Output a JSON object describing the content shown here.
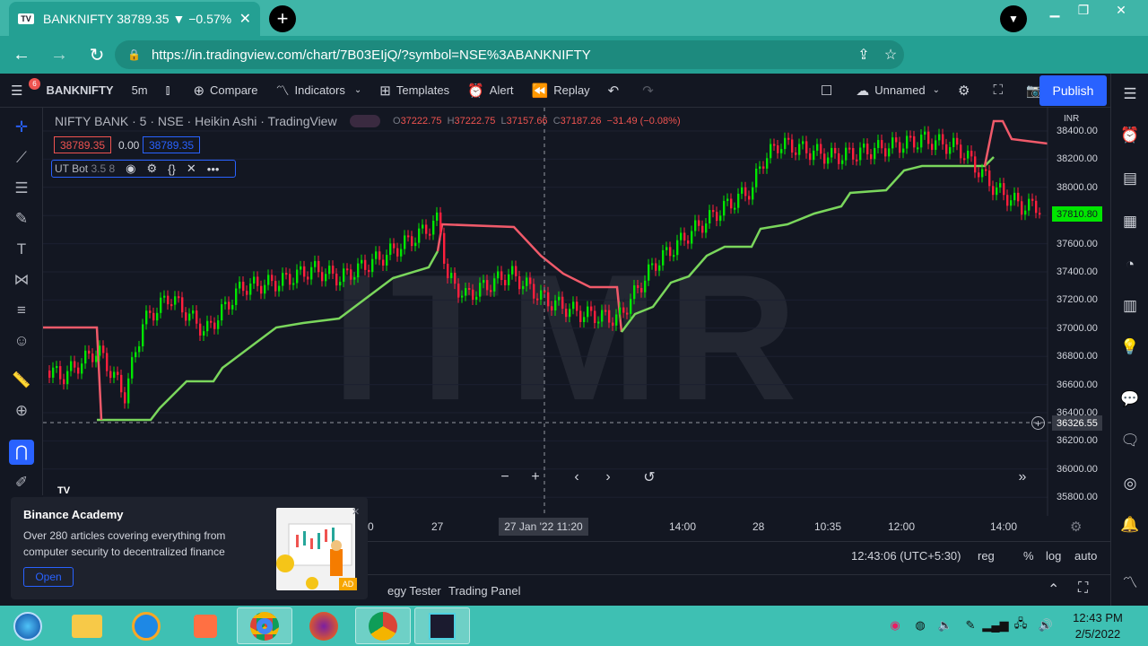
{
  "browser": {
    "tab_title": "BANKNIFTY 38789.35 ▼ −0.57% ",
    "tab_close": "✕",
    "new_tab": "+",
    "url": "https://in.tradingview.com/chart/7B03EIjQ/?symbol=NSE%3ABANKNIFTY"
  },
  "toolbar": {
    "symbol": "BANKNIFTY",
    "interval": "5m",
    "compare": "Compare",
    "indicators": "Indicators",
    "templates": "Templates",
    "alert": "Alert",
    "replay": "Replay",
    "layout_name": "Unnamed",
    "publish": "Publish",
    "notif_count": "6"
  },
  "legend": {
    "title": "NIFTY BANK · 5 · NSE · Heikin Ashi · TradingView",
    "o_label": "O",
    "o_value": "37222.75",
    "h_label": "H",
    "h_value": "37222.75",
    "l_label": "L",
    "l_value": "37157.66",
    "c_label": "C",
    "c_value": "37187.26",
    "change": "−31.49 (−0.08%)",
    "bid": "38789.35",
    "spread": "0.00",
    "ask": "38789.35",
    "indicator": "UT Bot",
    "indicator_params": "3.5 8"
  },
  "axis": {
    "currency": "INR",
    "price_ticks": [
      "38400.00",
      "38200.00",
      "38000.00",
      "37800.00",
      "37600.00",
      "37400.00",
      "37200.00",
      "37000.00",
      "36800.00",
      "36600.00",
      "36400.00",
      "36200.00",
      "36000.00",
      "35800.00"
    ],
    "last_price": "37810.80",
    "crosshair_price": "36326.55",
    "time_ticks": [
      "0",
      "27",
      "14:00",
      "28",
      "10:35",
      "12:00",
      "14:00"
    ],
    "crosshair_time": "27 Jan '22   11:20"
  },
  "watermark": "ITMR",
  "status": {
    "time": "12:43:06 (UTC+5:30)",
    "session": "reg",
    "percent": "%",
    "log": "log",
    "auto": "auto"
  },
  "bottom_panel": {
    "tab1": "egy Tester",
    "tab2": "Trading Panel"
  },
  "ad": {
    "title": "Binance Academy",
    "description": "Over 280 articles covering everything from computer security to decentralized finance",
    "button": "Open",
    "tag": "AD"
  },
  "taskbar": {
    "time": "12:43 PM",
    "date": "2/5/2022"
  },
  "colors": {
    "bull": "#00e600",
    "bear": "#ff1f3d",
    "trail_up": "#7ad65c",
    "trail_down": "#f05a6a",
    "accent": "#2962ff"
  }
}
